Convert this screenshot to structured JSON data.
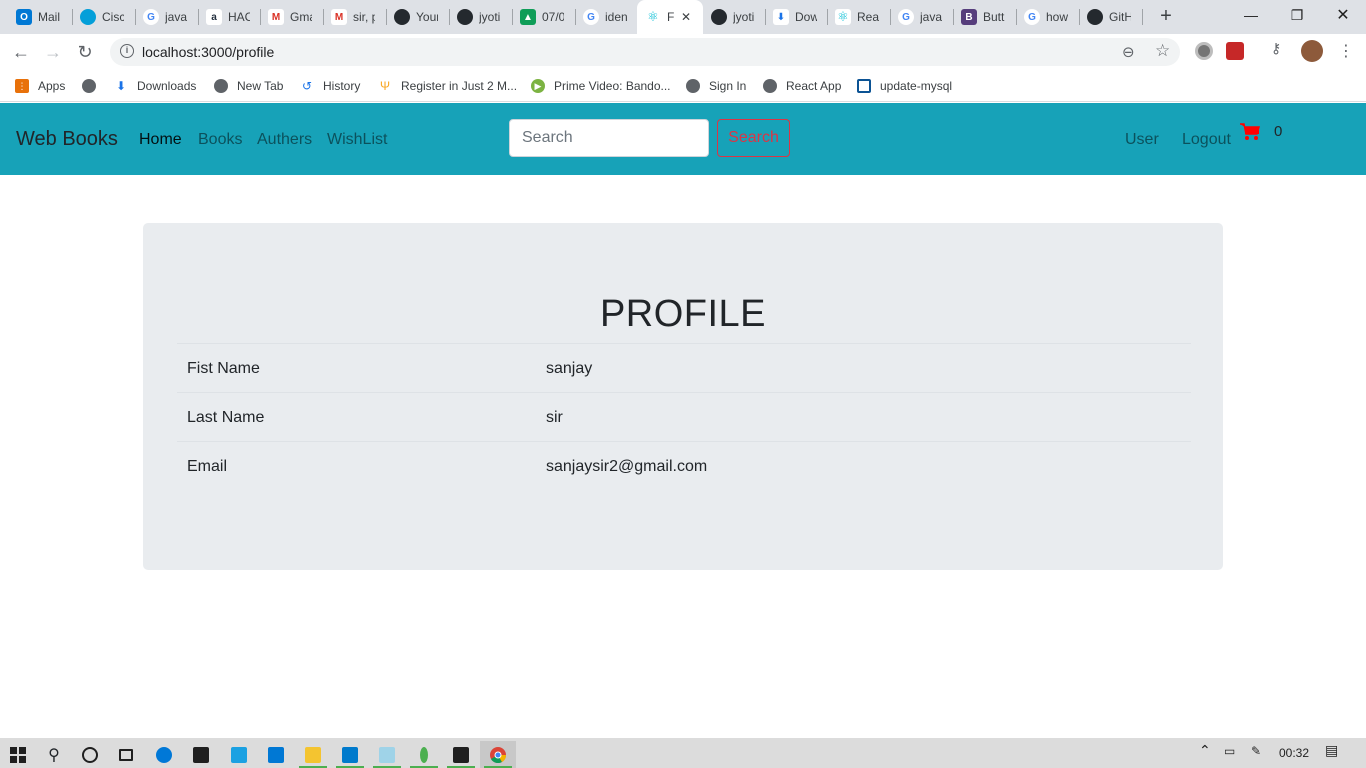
{
  "browser": {
    "tabs": [
      {
        "title": "Mail",
        "icon": "outlook-icon",
        "color": "#0078d4"
      },
      {
        "title": "Cisco",
        "icon": "cisco-icon",
        "color": "#049fd9"
      },
      {
        "title": "java",
        "icon": "google-icon",
        "color": "#4285f4"
      },
      {
        "title": "HAC",
        "icon": "amazon-icon",
        "color": "#232f3e"
      },
      {
        "title": "Gma",
        "icon": "gmail-icon",
        "color": "#d93025"
      },
      {
        "title": "sir, p",
        "icon": "gmail-icon",
        "color": "#d93025"
      },
      {
        "title": "Your",
        "icon": "github-icon",
        "color": "#24292e"
      },
      {
        "title": "jyoti",
        "icon": "github-icon",
        "color": "#24292e"
      },
      {
        "title": "07/0",
        "icon": "drive-icon",
        "color": "#0f9d58"
      },
      {
        "title": "iden",
        "icon": "google-icon",
        "color": "#4285f4"
      },
      {
        "title": "F",
        "icon": "react-icon",
        "color": "#00bcd4"
      },
      {
        "title": "jyoti",
        "icon": "github-icon",
        "color": "#24292e"
      },
      {
        "title": "Dow",
        "icon": "download-icon",
        "color": "#1a73e8"
      },
      {
        "title": "Reac",
        "icon": "react-icon",
        "color": "#00bcd4"
      },
      {
        "title": "java",
        "icon": "google-icon",
        "color": "#4285f4"
      },
      {
        "title": "Butt",
        "icon": "bootstrap-icon",
        "color": "#563d7c"
      },
      {
        "title": "how",
        "icon": "google-icon",
        "color": "#4285f4"
      },
      {
        "title": "GitH",
        "icon": "github-icon",
        "color": "#24292e"
      }
    ],
    "url": "localhost:3000/profile",
    "bookmarks": [
      {
        "label": "Apps",
        "icon": "apps-grid-icon"
      },
      {
        "label": "",
        "icon": "globe-icon"
      },
      {
        "label": "Downloads",
        "icon": "download-icon"
      },
      {
        "label": "New Tab",
        "icon": "globe-icon"
      },
      {
        "label": "History",
        "icon": "history-icon"
      },
      {
        "label": "Register in Just 2 M...",
        "icon": "plant-icon"
      },
      {
        "label": "Prime Video: Bando...",
        "icon": "play-icon"
      },
      {
        "label": "Sign In",
        "icon": "globe-icon"
      },
      {
        "label": "React App",
        "icon": "globe-icon"
      },
      {
        "label": "update-mysql",
        "icon": "doc-icon"
      }
    ]
  },
  "navbar": {
    "brand": "Web Books",
    "links": [
      "Home",
      "Books",
      "Authers",
      "WishList"
    ],
    "search_placeholder": "Search",
    "search_button": "Search",
    "user_link": "User",
    "logout_link": "Logout",
    "cart_count": "0",
    "colors": {
      "background": "#17a2b8",
      "danger": "#dc3545"
    }
  },
  "profile": {
    "title": "PROFILE",
    "rows": [
      {
        "label": "Fist Name",
        "value": "sanjay"
      },
      {
        "label": "Last Name",
        "value": "sir"
      },
      {
        "label": "Email",
        "value": "sanjaysir2@gmail.com"
      }
    ]
  },
  "taskbar": {
    "time": "00:32"
  }
}
